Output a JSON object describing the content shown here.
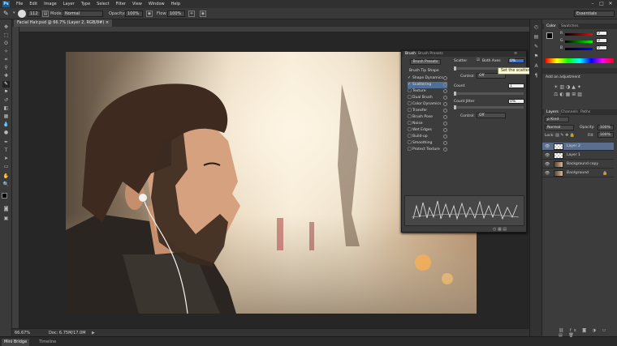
{
  "app": {
    "logo": "Ps"
  },
  "menu": [
    "File",
    "Edit",
    "Image",
    "Layer",
    "Type",
    "Select",
    "Filter",
    "View",
    "Window",
    "Help"
  ],
  "options_bar": {
    "brush_size": "112",
    "mode_label": "Mode:",
    "mode_value": "Normal",
    "opacity_label": "Opacity:",
    "opacity_value": "100%",
    "flow_label": "Flow:",
    "flow_value": "100%",
    "workspace": "Essentials"
  },
  "document": {
    "tab_title": "Facial Hair.psd @ 66.7% (Layer 2, RGB/8#)"
  },
  "status": {
    "zoom": "66.67%",
    "doc_info": "Doc: 6.75M/17.0M"
  },
  "mini_bridge": {
    "tabs": [
      "Mini Bridge",
      "Timeline"
    ]
  },
  "brush_panel": {
    "tabs": [
      "Brush",
      "Brush Presets"
    ],
    "presets_button": "Brush Presets",
    "tip_shape": "Brush Tip Shape",
    "items": [
      {
        "label": "Shape Dynamics",
        "checked": true
      },
      {
        "label": "Scattering",
        "checked": true
      },
      {
        "label": "Texture",
        "checked": false
      },
      {
        "label": "Dual Brush",
        "checked": false
      },
      {
        "label": "Color Dynamics",
        "checked": false
      },
      {
        "label": "Transfer",
        "checked": false
      },
      {
        "label": "Brush Pose",
        "checked": false
      },
      {
        "label": "Noise",
        "checked": false
      },
      {
        "label": "Wet Edges",
        "checked": false
      },
      {
        "label": "Build-up",
        "checked": false
      },
      {
        "label": "Smoothing",
        "checked": false
      },
      {
        "label": "Protect Texture",
        "checked": false
      }
    ],
    "scatter_label": "Scatter",
    "both_axes": "Both Axes",
    "scatter_value": "0%",
    "control_label": "Control:",
    "control_value": "Off",
    "count_label": "Count",
    "count_value": "1",
    "count_jitter_label": "Count Jitter",
    "count_jitter_value": "0%",
    "control2_label": "Control:",
    "control2_value": "Off"
  },
  "tooltip": "Set the scatter randomness",
  "color_panel": {
    "tabs": [
      "Color",
      "Swatches"
    ],
    "r": "0",
    "g": "0",
    "b": "0"
  },
  "adjustments": {
    "title": "Add an adjustment"
  },
  "layers_panel": {
    "tabs": [
      "Layers",
      "Channels",
      "Paths"
    ],
    "kind": "Kind",
    "blend_mode": "Normal",
    "opacity_label": "Opacity:",
    "opacity_value": "100%",
    "lock_label": "Lock:",
    "fill_label": "Fill:",
    "fill_value": "100%",
    "layers": [
      {
        "name": "Layer 2",
        "selected": true
      },
      {
        "name": "Layer 1",
        "selected": false
      },
      {
        "name": "Background copy",
        "selected": false
      },
      {
        "name": "Background",
        "selected": false
      }
    ]
  }
}
